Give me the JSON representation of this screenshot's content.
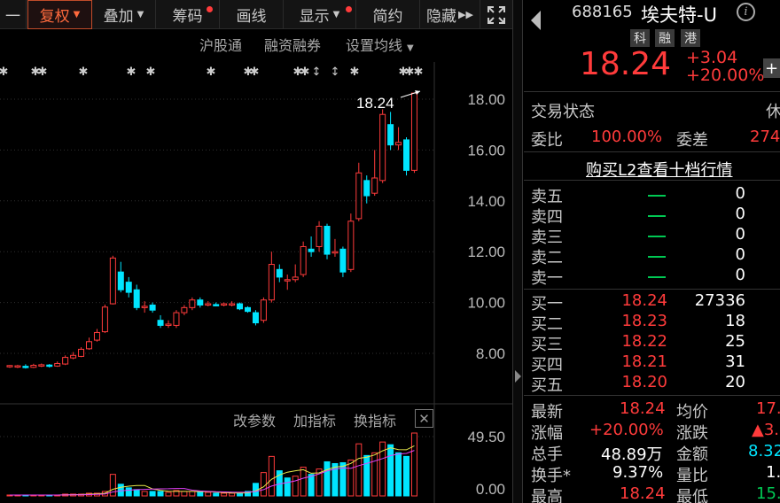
{
  "toolbar": {
    "first": "一",
    "fuquan": "复权",
    "diejia": "叠加",
    "chouma": "筹码",
    "huaxian": "画线",
    "xianshi": "显示",
    "jianyue": "简约",
    "yincang": "隐藏"
  },
  "subtoolbar": {
    "hgt": "沪股通",
    "rzrq": "融资融券",
    "szjx": "设置均线"
  },
  "price_chart": {
    "y_ticks": [
      "18.00",
      "16.00",
      "14.00",
      "12.00",
      "10.00",
      "8.00"
    ],
    "last_label": "18.24",
    "candles": [
      {
        "o": 7.48,
        "c": 7.52,
        "h": 7.54,
        "l": 7.43
      },
      {
        "o": 7.47,
        "c": 7.51,
        "h": 7.55,
        "l": 7.42
      },
      {
        "o": 7.49,
        "c": 7.46,
        "h": 7.57,
        "l": 7.4
      },
      {
        "o": 7.45,
        "c": 7.53,
        "h": 7.59,
        "l": 7.42
      },
      {
        "o": 7.52,
        "c": 7.55,
        "h": 7.6,
        "l": 7.46
      },
      {
        "o": 7.54,
        "c": 7.5,
        "h": 7.58,
        "l": 7.44
      },
      {
        "o": 7.5,
        "c": 7.6,
        "h": 7.68,
        "l": 7.47
      },
      {
        "o": 7.58,
        "c": 7.84,
        "h": 7.92,
        "l": 7.54
      },
      {
        "o": 7.82,
        "c": 7.92,
        "h": 8.05,
        "l": 7.77
      },
      {
        "o": 7.88,
        "c": 8.16,
        "h": 8.24,
        "l": 7.85
      },
      {
        "o": 8.18,
        "c": 8.46,
        "h": 8.62,
        "l": 8.14
      },
      {
        "o": 8.52,
        "c": 8.82,
        "h": 8.96,
        "l": 8.46
      },
      {
        "o": 8.85,
        "c": 9.82,
        "h": 9.92,
        "l": 8.8
      },
      {
        "o": 9.95,
        "c": 11.75,
        "h": 11.84,
        "l": 9.92
      },
      {
        "o": 11.2,
        "c": 10.5,
        "h": 11.6,
        "l": 10.4
      },
      {
        "o": 10.8,
        "c": 10.4,
        "h": 11.0,
        "l": 10.2
      },
      {
        "o": 10.5,
        "c": 9.8,
        "h": 10.7,
        "l": 9.7
      },
      {
        "o": 9.8,
        "c": 9.85,
        "h": 10.05,
        "l": 9.6
      },
      {
        "o": 9.9,
        "c": 9.7,
        "h": 10.0,
        "l": 9.6
      },
      {
        "o": 9.3,
        "c": 9.1,
        "h": 9.5,
        "l": 9.0
      },
      {
        "o": 9.1,
        "c": 9.15,
        "h": 9.3,
        "l": 9.0
      },
      {
        "o": 9.1,
        "c": 9.6,
        "h": 9.7,
        "l": 9.0
      },
      {
        "o": 9.6,
        "c": 9.8,
        "h": 9.9,
        "l": 9.5
      },
      {
        "o": 9.8,
        "c": 10.1,
        "h": 10.2,
        "l": 9.7
      },
      {
        "o": 10.1,
        "c": 9.9,
        "h": 10.2,
        "l": 9.8
      },
      {
        "o": 9.9,
        "c": 9.95,
        "h": 10.05,
        "l": 9.85
      },
      {
        "o": 9.92,
        "c": 9.9,
        "h": 10.0,
        "l": 9.85
      },
      {
        "o": 9.9,
        "c": 9.95,
        "h": 10.0,
        "l": 9.85
      },
      {
        "o": 9.9,
        "c": 9.95,
        "h": 10.05,
        "l": 9.85
      },
      {
        "o": 9.95,
        "c": 9.75,
        "h": 10.0,
        "l": 9.7
      },
      {
        "o": 9.8,
        "c": 9.65,
        "h": 9.85,
        "l": 9.6
      },
      {
        "o": 9.6,
        "c": 9.2,
        "h": 9.7,
        "l": 9.1
      },
      {
        "o": 9.3,
        "c": 10.1,
        "h": 10.2,
        "l": 9.2
      },
      {
        "o": 10.1,
        "c": 11.5,
        "h": 12.0,
        "l": 10.0
      },
      {
        "o": 11.3,
        "c": 11.0,
        "h": 11.5,
        "l": 10.8
      },
      {
        "o": 10.9,
        "c": 10.9,
        "h": 11.1,
        "l": 10.5
      },
      {
        "o": 10.9,
        "c": 11.0,
        "h": 11.5,
        "l": 10.8
      },
      {
        "o": 11.1,
        "c": 12.2,
        "h": 12.4,
        "l": 11.0
      },
      {
        "o": 12.1,
        "c": 12.0,
        "h": 12.6,
        "l": 11.8
      },
      {
        "o": 12.2,
        "c": 13.0,
        "h": 13.2,
        "l": 12.0
      },
      {
        "o": 13.0,
        "c": 11.9,
        "h": 13.1,
        "l": 11.7
      },
      {
        "o": 12.0,
        "c": 12.0,
        "h": 12.5,
        "l": 11.8
      },
      {
        "o": 12.1,
        "c": 11.2,
        "h": 12.2,
        "l": 11.0
      },
      {
        "o": 11.3,
        "c": 13.2,
        "h": 13.5,
        "l": 11.2
      },
      {
        "o": 13.3,
        "c": 15.1,
        "h": 15.5,
        "l": 13.2
      },
      {
        "o": 14.8,
        "c": 14.2,
        "h": 15.0,
        "l": 13.9
      },
      {
        "o": 14.3,
        "c": 14.9,
        "h": 16.0,
        "l": 14.2
      },
      {
        "o": 14.8,
        "c": 17.4,
        "h": 17.6,
        "l": 14.7
      },
      {
        "o": 17.0,
        "c": 16.2,
        "h": 17.5,
        "l": 16.0
      },
      {
        "o": 16.2,
        "c": 16.3,
        "h": 16.9,
        "l": 16.0
      },
      {
        "o": 16.4,
        "c": 15.2,
        "h": 16.5,
        "l": 15.0
      },
      {
        "o": 15.2,
        "c": 18.24,
        "h": 18.24,
        "l": 15.1
      }
    ]
  },
  "volume_chart": {
    "menu": [
      "改参数",
      "加指标",
      "换指标"
    ],
    "y_ticks": [
      "49.50",
      "0.00"
    ],
    "bars": [
      {
        "v": 1,
        "u": 1
      },
      {
        "v": 1,
        "u": 1
      },
      {
        "v": 1,
        "u": 0
      },
      {
        "v": 1,
        "u": 1
      },
      {
        "v": 1,
        "u": 1
      },
      {
        "v": 1,
        "u": 0
      },
      {
        "v": 1,
        "u": 1
      },
      {
        "v": 2,
        "u": 1
      },
      {
        "v": 2,
        "u": 1
      },
      {
        "v": 2,
        "u": 1
      },
      {
        "v": 3,
        "u": 1
      },
      {
        "v": 3,
        "u": 1
      },
      {
        "v": 5,
        "u": 1
      },
      {
        "v": 24,
        "u": 1
      },
      {
        "v": 13,
        "u": 0
      },
      {
        "v": 9,
        "u": 0
      },
      {
        "v": 7,
        "u": 0
      },
      {
        "v": 5,
        "u": 1
      },
      {
        "v": 5,
        "u": 0
      },
      {
        "v": 5,
        "u": 0
      },
      {
        "v": 4,
        "u": 1
      },
      {
        "v": 6,
        "u": 1
      },
      {
        "v": 5,
        "u": 1
      },
      {
        "v": 5,
        "u": 1
      },
      {
        "v": 4,
        "u": 0
      },
      {
        "v": 4,
        "u": 1
      },
      {
        "v": 3,
        "u": 0
      },
      {
        "v": 3,
        "u": 1
      },
      {
        "v": 3,
        "u": 1
      },
      {
        "v": 3,
        "u": 0
      },
      {
        "v": 5,
        "u": 0
      },
      {
        "v": 14,
        "u": 0
      },
      {
        "v": 26,
        "u": 1
      },
      {
        "v": 44,
        "u": 1
      },
      {
        "v": 28,
        "u": 0
      },
      {
        "v": 20,
        "u": 0
      },
      {
        "v": 22,
        "u": 1
      },
      {
        "v": 32,
        "u": 1
      },
      {
        "v": 24,
        "u": 0
      },
      {
        "v": 30,
        "u": 1
      },
      {
        "v": 38,
        "u": 0
      },
      {
        "v": 36,
        "u": 0
      },
      {
        "v": 37,
        "u": 0
      },
      {
        "v": 40,
        "u": 1
      },
      {
        "v": 58,
        "u": 1
      },
      {
        "v": 45,
        "u": 0
      },
      {
        "v": 48,
        "u": 1
      },
      {
        "v": 60,
        "u": 1
      },
      {
        "v": 57,
        "u": 0
      },
      {
        "v": 48,
        "u": 0
      },
      {
        "v": 44,
        "u": 0
      },
      {
        "v": 70,
        "u": 1
      }
    ]
  },
  "quote": {
    "code": "688165",
    "name": "埃夫特-U",
    "tags": [
      "科",
      "融",
      "港"
    ],
    "price": "18.24",
    "change": "+3.04",
    "change_pct": "+20.00%",
    "trade_status_label": "交易状态",
    "trade_status_value": "休",
    "weibi_label": "委比",
    "weibi_value": "100.00%",
    "weicha_label": "委差",
    "weicha_value": "274",
    "l2_link": "购买L2查看十档行情",
    "sells": [
      {
        "label": "卖五",
        "vol": "0"
      },
      {
        "label": "卖四",
        "vol": "0"
      },
      {
        "label": "卖三",
        "vol": "0"
      },
      {
        "label": "卖二",
        "vol": "0"
      },
      {
        "label": "卖一",
        "vol": "0"
      }
    ],
    "buys": [
      {
        "label": "买一",
        "price": "18.24",
        "vol": "27336"
      },
      {
        "label": "买二",
        "price": "18.23",
        "vol": "18"
      },
      {
        "label": "买三",
        "price": "18.22",
        "vol": "25"
      },
      {
        "label": "买四",
        "price": "18.21",
        "vol": "31"
      },
      {
        "label": "买五",
        "price": "18.20",
        "vol": "20"
      }
    ],
    "stats": {
      "zuixin_l": "最新",
      "zuixin_v": "18.24",
      "junjia_l": "均价",
      "junjia_v": "17.",
      "zhangfu_l": "涨幅",
      "zhangfu_v": "+20.00%",
      "zhangdie_l": "涨跌",
      "zhangdie_v": "▲3.",
      "zongshou_l": "总手",
      "zongshou_v": "48.89万",
      "jine_l": "金额",
      "jine_v": "8.32",
      "huanshou_l": "换手*",
      "huanshou_v": "9.37%",
      "liangbi_l": "量比",
      "liangbi_v": "1.",
      "zuigao_l": "最高",
      "zuigao_v": "18.24",
      "zuidi_l": "最低",
      "zuidi_v": "15."
    }
  },
  "colors": {
    "up": "#ff3b3b",
    "down": "#00e5ff",
    "accent": "#ff6a3d"
  }
}
